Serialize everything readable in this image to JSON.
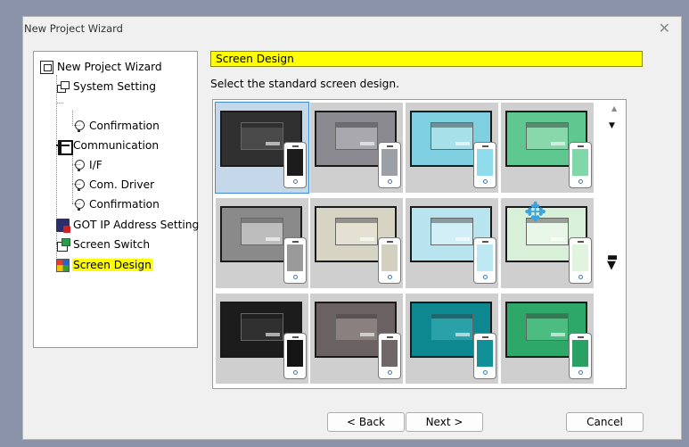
{
  "window": {
    "title": "New Project Wizard",
    "close_glyph": "✕"
  },
  "tree": {
    "root": "New Project Wizard",
    "items": [
      {
        "label": "System Setting"
      },
      {
        "label": "Confirmation"
      },
      {
        "label": "Communication"
      },
      {
        "label": "I/F"
      },
      {
        "label": "Com. Driver"
      },
      {
        "label": "Confirmation"
      },
      {
        "label": "GOT IP Address Setting"
      },
      {
        "label": "Screen Switch"
      },
      {
        "label": "Screen Design"
      }
    ],
    "selected_index": 8
  },
  "header": {
    "title": "Screen Design"
  },
  "instruction": "Select the standard screen design.",
  "designs": [
    {
      "screen": "#303030",
      "dialog": "#4a4a4a",
      "phone": "#1c1c1c"
    },
    {
      "screen": "#8a8a90",
      "dialog": "#a8a8ae",
      "phone": "#9aa0a6"
    },
    {
      "screen": "#7ed0e0",
      "dialog": "#a8e0ea",
      "phone": "#8edcec"
    },
    {
      "screen": "#5ec890",
      "dialog": "#88d8ac",
      "phone": "#80d8a8"
    },
    {
      "screen": "#8a8a8a",
      "dialog": "#bdbdbd",
      "phone": "#9a9a9a"
    },
    {
      "screen": "#d8d4c4",
      "dialog": "#e4e0d2",
      "phone": "#d4d0c0"
    },
    {
      "screen": "#b8e4f0",
      "dialog": "#d2eef6",
      "phone": "#bce8f4"
    },
    {
      "screen": "#d8f0d8",
      "dialog": "#e8f6e8",
      "phone": "#e0f4e0"
    },
    {
      "screen": "#1c1c1c",
      "dialog": "#303030",
      "phone": "#141414"
    },
    {
      "screen": "#6a6262",
      "dialog": "#8a8080",
      "phone": "#706868"
    },
    {
      "screen": "#0e8890",
      "dialog": "#2aa0a8",
      "phone": "#129098"
    },
    {
      "screen": "#2ea868",
      "dialog": "#4cbc80",
      "phone": "#2aa064"
    }
  ],
  "selected_design": 0,
  "drag_icon": "✥",
  "scroll": {
    "up": "▲",
    "down": "▼"
  },
  "buttons": {
    "back": "< Back",
    "next": "Next >",
    "cancel": "Cancel"
  }
}
